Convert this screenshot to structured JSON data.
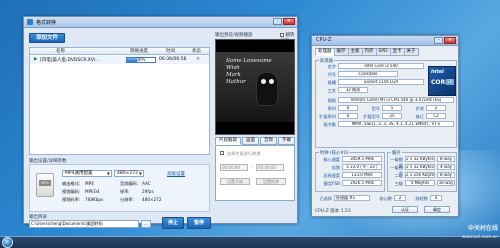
{
  "converter": {
    "title": "格式转换",
    "add_file": "添加文件",
    "col_name": "名称",
    "col_progress": "转换进度",
    "col_time": "时间",
    "col_status": "状态",
    "file_name": "[闪电]美人鱼.DVDSCR.XVi...",
    "progress_text": "36%",
    "progress_fraction": 0.36,
    "time": "06:36/06:56",
    "output_settings_label": "输出设置/详细参数",
    "profile": "MP4通用配置",
    "resolution": "480×272",
    "advanced_link": "高级设置",
    "params": {
      "out_format_k": "输出格式:",
      "out_format_v": "MP4",
      "v_enc_k": "视频编码:",
      "v_enc_v": "MPEG4",
      "v_bitrate_k": "视频码率:",
      "v_bitrate_v": "768Kbps",
      "a_enc_k": "音频编码:",
      "a_enc_v": "AAC",
      "fps_k": "帧率:",
      "fps_v": "29fps",
      "size_k": "分辨率:",
      "size_v": "480×272"
    },
    "output_dir_label": "输出目录",
    "output_path": "C:\\Users\\cheng\\Documents\\美团转码",
    "browse": "...",
    "stop_button": "停止",
    "pause_button": "暂停",
    "preview_label": "输出预览/视频播放",
    "preview_check": "翻转画面",
    "video_title_lines": [
      "Some Lonesome",
      "Wish",
      "Mark",
      "Hathor"
    ],
    "tabs": [
      "片段截取",
      "画面",
      "音频",
      "字幕"
    ],
    "clip_check": "选择片段进行转换",
    "time_start": "00:00:00",
    "time_end": "00:00:00",
    "btn_set_start": "设置开始",
    "btn_set_end": "设置结束"
  },
  "cpuz": {
    "title": "CPU-Z",
    "tabs": [
      "处理器",
      "缓存",
      "主板",
      "内存",
      "SPD",
      "显卡",
      "关于"
    ],
    "processor_group": "处理器",
    "name_k": "名字",
    "name_v": "Intel Core i3 540",
    "code_k": "代号",
    "code_v": "Clarkdale",
    "pkg_k": "插槽",
    "pkg_v": "Socket 1156 LGA",
    "tech_k": "工艺",
    "tech_v": "32 纳米",
    "spec_k": "规格",
    "spec_v": "Intel(R) Core(TM) i3 CPU 540 @ 3.07GHz (ES)",
    "family_k": "系列",
    "family_v": "6",
    "model_k": "型号",
    "model_v": "5",
    "stepping_k": "步进",
    "stepping_v": "2",
    "ext_family_k": "扩展系列",
    "ext_family_v": "6",
    "ext_model_k": "扩展型号",
    "ext_model_v": "25",
    "revision_k": "修订",
    "revision_v": "C2",
    "instr_k": "指令集",
    "instr_v": "MMX, SSE(1, 2, 3, 3S, 4.1, 4.2), EM64T, VT-x",
    "clock_group": "时钟 (核心#0)",
    "core_speed_k": "核心速度",
    "core_speed_v": "3059.5 MHz",
    "multi_k": "倍频",
    "multi_v": "x 23.0 ( 9 - 23 )",
    "bus_k": "总线速度",
    "bus_v": "133.0 MHz",
    "qpi_k": "额定FSB",
    "qpi_v": "2926.5 MHz",
    "cache_group": "缓存",
    "l1d_k": "一级数据",
    "l1d_v": "2 x 32 KBytes",
    "l1d_w": "8-way",
    "l1i_k": "一级指令",
    "l1i_v": "2 x 32 KBytes",
    "l1i_w": "4-way",
    "l2_k": "二级",
    "l2_v": "2 x 256 KBytes",
    "l2_w": "8-way",
    "l3_k": "三级",
    "l3_v": "4 MBytes",
    "l3_w": "16-way",
    "selection_k": "已选择",
    "selection_v": "处理器 #1",
    "cores_k": "核心数",
    "cores_v": "2",
    "threads_k": "线程数",
    "threads_v": "4",
    "version": "版本 1.53",
    "validate_button": "认证",
    "ok_button": "确定",
    "intel_brand": "intel",
    "intel_core": "CORE",
    "intel_tier": "i3"
  },
  "watermark": {
    "brand": "中关村在线",
    "url": "www.zol.com.cn"
  }
}
